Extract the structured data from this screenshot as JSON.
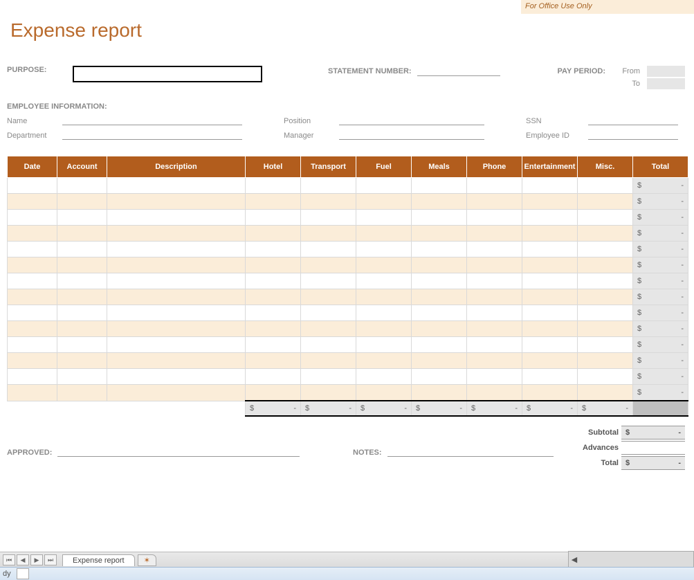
{
  "office_use": "For Office Use Only",
  "title": "Expense report",
  "purpose_label": "PURPOSE:",
  "statement_label": "STATEMENT NUMBER:",
  "pay_period_label": "PAY PERIOD:",
  "pay_from": "From",
  "pay_to": "To",
  "emp_info_label": "EMPLOYEE INFORMATION:",
  "emp": {
    "name": "Name",
    "department": "Department",
    "position": "Position",
    "manager": "Manager",
    "ssn": "SSN",
    "employee_id": "Employee ID"
  },
  "headers": [
    "Date",
    "Account",
    "Description",
    "Hotel",
    "Transport",
    "Fuel",
    "Meals",
    "Phone",
    "Entertainment",
    "Misc.",
    "Total"
  ],
  "currency": "$",
  "dash": "-",
  "row_count": 14,
  "sum_cols": 7,
  "summary": {
    "subtotal": "Subtotal",
    "advances": "Advances",
    "total": "Total"
  },
  "approved_label": "APPROVED:",
  "notes_label": "NOTES:",
  "tab_name": "Expense report",
  "status": "dy"
}
